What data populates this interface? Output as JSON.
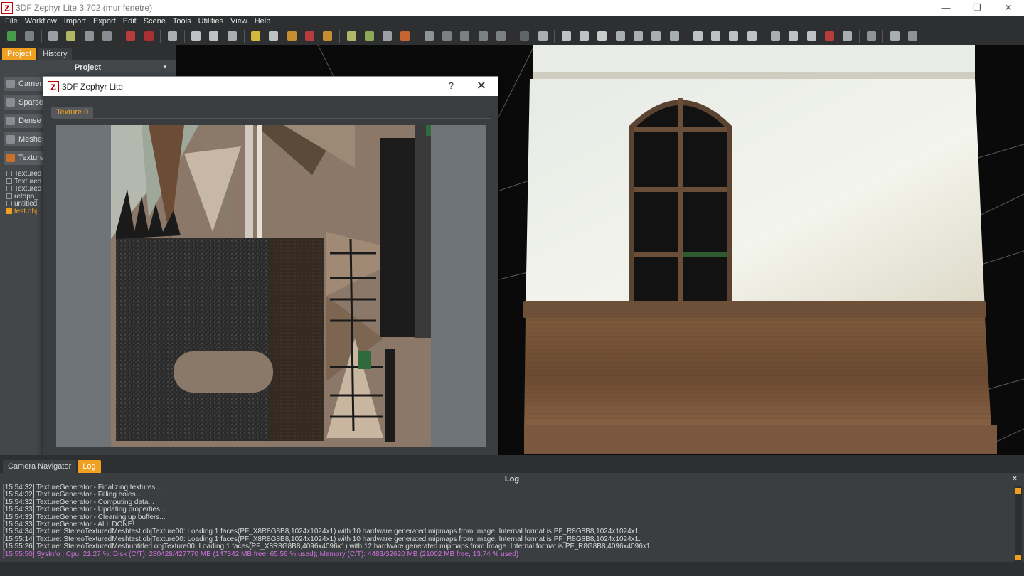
{
  "window": {
    "title": "3DF Zephyr Lite 3.702 (mur fenetre)",
    "logo": "Z",
    "minimize": "—",
    "maximize": "❐",
    "close": "✕"
  },
  "menu": [
    "File",
    "Workflow",
    "Import",
    "Export",
    "Edit",
    "Scene",
    "Tools",
    "Utilities",
    "View",
    "Help"
  ],
  "toolbar": {
    "icons": [
      "new-project-icon",
      "save-icon",
      "sep",
      "cameras-icon",
      "sparse-icon",
      "dense-icon",
      "mesh-icon",
      "sep",
      "texture-icon",
      "texture-red-icon",
      "sep",
      "screenshot-icon",
      "sep",
      "rotate-icon",
      "orbit-icon",
      "ortho-icon",
      "sep",
      "light-icon",
      "triangle-icon",
      "triangle-colored-icon",
      "triangle-red-icon",
      "brush-icon",
      "sep",
      "points-icon",
      "points-green-icon",
      "box-icon",
      "cube-color-icon",
      "sep",
      "fit-icon",
      "view-front-icon",
      "view-side-icon",
      "view-top-icon",
      "view-persp-icon",
      "sep",
      "undo-icon",
      "redo-icon",
      "sep",
      "select-icon",
      "select-remove-icon",
      "mask-icon",
      "select-box-icon",
      "select-lasso-icon",
      "select-all-icon",
      "select-invert-icon",
      "sep",
      "measure-icon",
      "measure2-icon",
      "crop-icon",
      "solid-icon",
      "sep",
      "bbox-icon",
      "ruler-icon",
      "pick-icon",
      "axes-icon",
      "grid-icon",
      "sep",
      "filter-icon",
      "sep",
      "vr-icon",
      "help-icon"
    ]
  },
  "left_panel": {
    "tabs": [
      "Project",
      "History"
    ],
    "header": "Project",
    "close": "×",
    "nodes": [
      "Cameras",
      "Sparse",
      "Dense",
      "Meshes",
      "Textured"
    ],
    "files": [
      "Textured",
      "Textured",
      "Textured",
      "retopo_",
      "untitled.",
      "test.obj"
    ]
  },
  "dialog": {
    "title": "3DF Zephyr Lite",
    "help": "?",
    "close": "✕",
    "tab": "Texture 0"
  },
  "bottom_tabs": [
    "Camera Navigator",
    "Log"
  ],
  "log": {
    "header": "Log",
    "close": "×",
    "lines": [
      "[15:54:32] TextureGenerator - Finalizing textures...",
      "[15:54:32] TextureGenerator - Filling holes...",
      "[15:54:32] TextureGenerator - Computing data...",
      "[15:54:33] TextureGenerator - Updating properties...",
      "[15:54:33] TextureGenerator - Cleaning up buffers...",
      "[15:54:33] TextureGenerator - ALL DONE!",
      "[15:54:34] Texture: StereoTexturedMeshtest.objTexture00: Loading 1 faces(PF_X8R8G8B8,1024x1024x1) with 10 hardware generated mipmaps from Image. Internal format is PF_R8G8B8,1024x1024x1.",
      "[15:55:14] Texture: StereoTexturedMeshtest.objTexture00: Loading 1 faces(PF_X8R8G8B8,1024x1024x1) with 10 hardware generated mipmaps from Image. Internal format is PF_R8G8B8,1024x1024x1.",
      "[15:55:26] Texture: StereoTexturedMeshuntitled.objTexture00: Loading 1 faces(PF_X8R8G8B8,4096x4096x1) with 12 hardware generated mipmaps from Image. Internal format is PF_R8G8B8,4096x4096x1."
    ],
    "sysinfo": "[15:55:50] SysInfo | Cpu: 21.27 %; Disk (C/T): 280428/427770 MB (147342 MB free, 65.56 % used); Memory (C/T): 4483/32620 MB (21002 MB free, 13.74 % used)"
  },
  "colors": {
    "accent": "#f0a020",
    "panel": "#43474a",
    "bar": "#2d2f31",
    "sysinfo": "#d070e0"
  }
}
